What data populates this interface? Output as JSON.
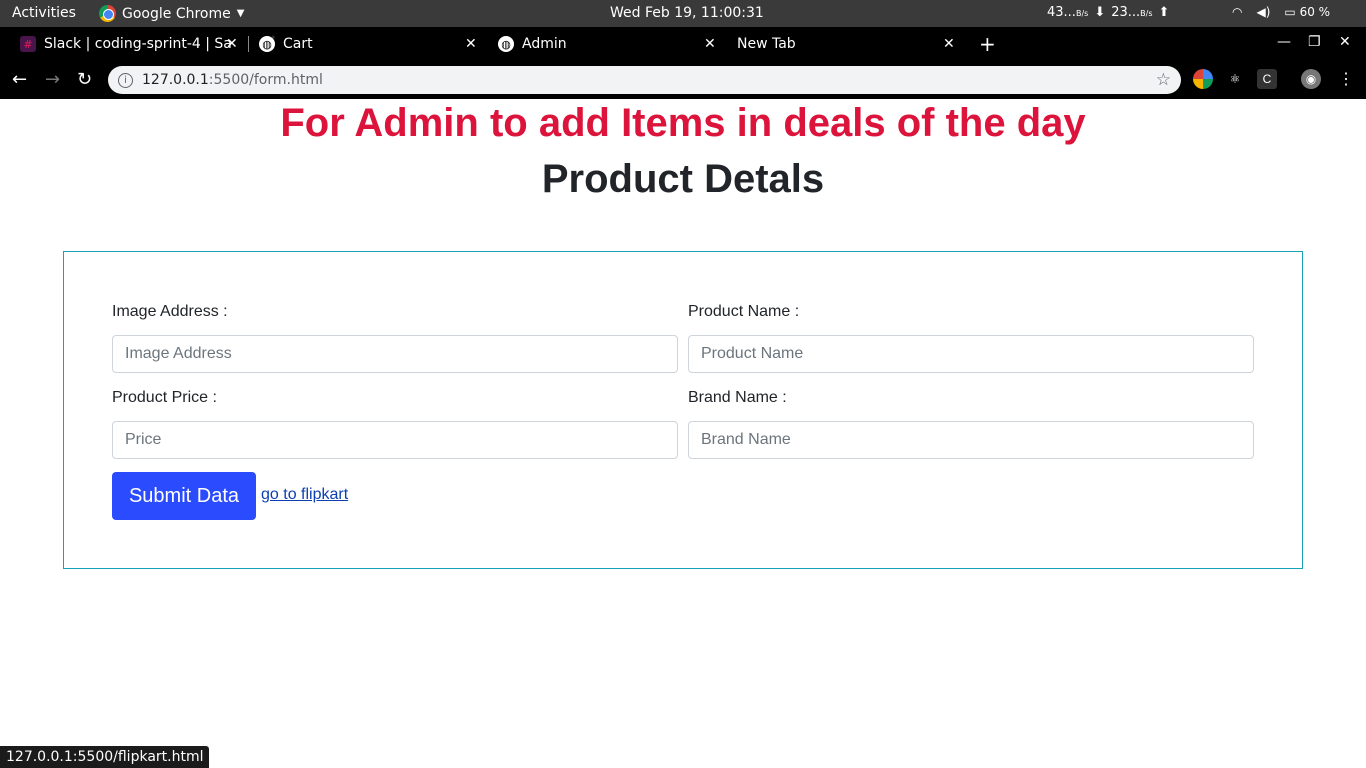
{
  "system_bar": {
    "activities": "Activities",
    "app_name": "Google Chrome",
    "clock": "Wed Feb 19, 11:00:31",
    "net_down": "43...",
    "net_down_unit": "B/s",
    "net_up": "23...",
    "net_up_unit": "B/s",
    "battery": "60 %"
  },
  "tabs": [
    {
      "title": "Slack | coding-sprint-4 | Sa",
      "icon": "slack-icon"
    },
    {
      "title": "Cart",
      "icon": "globe-icon"
    },
    {
      "title": "Admin",
      "icon": "globe-icon"
    },
    {
      "title": "New Tab",
      "icon": ""
    }
  ],
  "omnibox": {
    "host": "127.0.0.1",
    "path": ":5500/form.html"
  },
  "page": {
    "title": "For Admin to add Items in deals of the day",
    "subtitle": "Product Detals",
    "fields": [
      {
        "label": "Image Address :",
        "placeholder": "Image Address",
        "value": ""
      },
      {
        "label": "Product Name :",
        "placeholder": "Product Name",
        "value": ""
      },
      {
        "label": "Product Price :",
        "placeholder": "Price",
        "value": ""
      },
      {
        "label": "Brand Name :",
        "placeholder": "Brand Name",
        "value": ""
      }
    ],
    "submit_label": "Submit Data",
    "link_label": "go to flipkart"
  },
  "status_url": "127.0.0.1:5500/flipkart.html",
  "colors": {
    "title": "#dc143c",
    "submit_bg": "#2b4bff",
    "form_border": "#17a2b8"
  }
}
